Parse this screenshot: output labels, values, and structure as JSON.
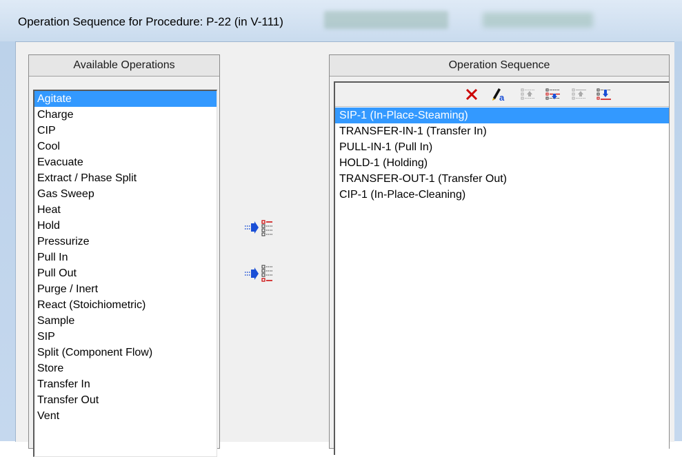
{
  "window": {
    "title": "Operation Sequence for Procedure: P-22 (in V-111)"
  },
  "available": {
    "header": "Available Operations",
    "items": [
      "Agitate",
      "Charge",
      "CIP",
      "Cool",
      "Evacuate",
      "Extract / Phase Split",
      "Gas Sweep",
      "Heat",
      "Hold",
      "Pressurize",
      "Pull In",
      "Pull Out",
      "Purge / Inert",
      "React (Stoichiometric)",
      "Sample",
      "SIP",
      "Split (Component Flow)",
      "Store",
      "Transfer In",
      "Transfer Out",
      "Vent"
    ],
    "selected_index": 0
  },
  "sequence": {
    "header": "Operation Sequence",
    "items": [
      "SIP-1 (In-Place-Steaming)",
      "TRANSFER-IN-1 (Transfer In)",
      "PULL-IN-1 (Pull In)",
      "HOLD-1 (Holding)",
      "TRANSFER-OUT-1 (Transfer Out)",
      "CIP-1 (In-Place-Cleaning)"
    ],
    "selected_index": 0,
    "toolbar_icons": [
      "delete-icon",
      "rename-icon",
      "move-up-icon",
      "move-down-icon",
      "move-to-top-icon",
      "move-to-bottom-icon"
    ]
  },
  "transfer_buttons": {
    "icons": [
      "insert-before-icon",
      "append-after-icon"
    ]
  },
  "colors": {
    "selection": "#3399ff",
    "delete_red": "#cc0000",
    "arrow_blue": "#1a4fd6"
  }
}
